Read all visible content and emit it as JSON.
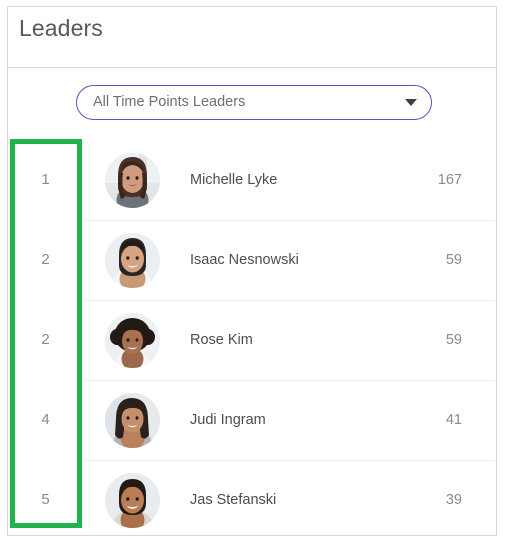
{
  "header": {
    "title": "Leaders"
  },
  "filter": {
    "selected": "All Time Points Leaders",
    "arrow_icon": "chevron-down-icon",
    "border_color": "#5b4fbe",
    "options": [
      "All Time Points Leaders"
    ]
  },
  "annotation": {
    "shape": "rectangle",
    "color": "#22b24c",
    "target": "rank-column"
  },
  "leaderboard": {
    "rows": [
      {
        "rank": "1",
        "name": "Michelle Lyke",
        "points": "167",
        "avatar": "avatar-michelle-lyke"
      },
      {
        "rank": "2",
        "name": "Isaac Nesnowski",
        "points": "59",
        "avatar": "avatar-isaac-nesnowski"
      },
      {
        "rank": "2",
        "name": "Rose Kim",
        "points": "59",
        "avatar": "avatar-rose-kim"
      },
      {
        "rank": "4",
        "name": "Judi Ingram",
        "points": "41",
        "avatar": "avatar-judi-ingram"
      },
      {
        "rank": "5",
        "name": "Jas Stefanski",
        "points": "39",
        "avatar": "avatar-jas-stefanski"
      }
    ]
  }
}
